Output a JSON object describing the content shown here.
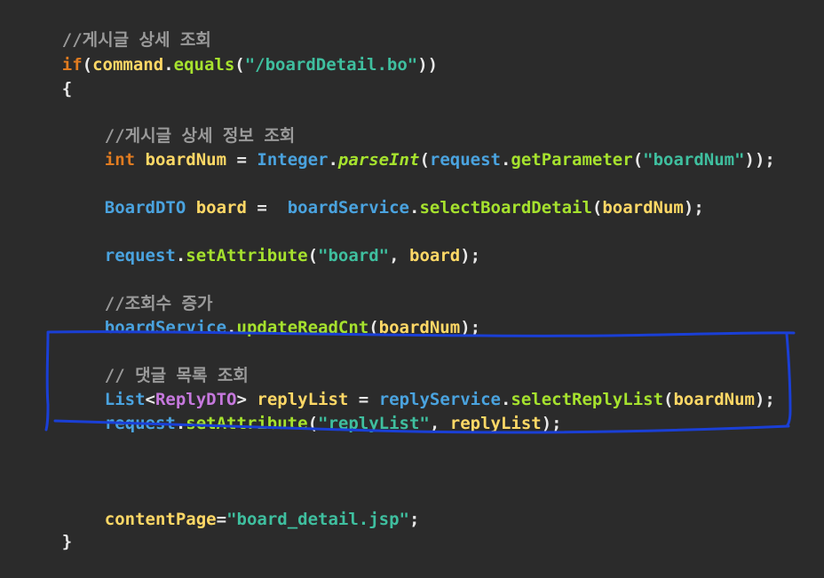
{
  "editor": {
    "lines": {
      "l1": {
        "comment": "//게시글 상세 조회"
      },
      "l2": {
        "kw": "if",
        "open": "(",
        "obj": "command",
        "dot": ".",
        "method": "equals",
        "p1": "(",
        "str": "\"/boardDetail.bo\"",
        "close": "))"
      },
      "l3": {
        "brace": "{"
      },
      "l5": {
        "comment": "//게시글 상세 정보 조회"
      },
      "l6": {
        "type": "int",
        "var": "boardNum",
        "eq": " = ",
        "cls": "Integer",
        "dot": ".",
        "method": "parseInt",
        "p1": "(",
        "obj": "request",
        "dot2": ".",
        "method2": "getParameter",
        "p2": "(",
        "str": "\"boardNum\"",
        "close": "));"
      },
      "l8": {
        "type": "BoardDTO",
        "var": "board",
        "eq": " =  ",
        "obj": "boardService",
        "dot": ".",
        "method": "selectBoardDetail",
        "p1": "(",
        "arg": "boardNum",
        "close": ");"
      },
      "l10": {
        "obj": "request",
        "dot": ".",
        "method": "setAttribute",
        "p1": "(",
        "str": "\"board\"",
        "comma": ", ",
        "arg": "board",
        "close": ");"
      },
      "l12": {
        "comment": "//조회수 증가"
      },
      "l13": {
        "obj": "boardService",
        "dot": ".",
        "method": "updateReadCnt",
        "p1": "(",
        "arg": "boardNum",
        "close": ");"
      },
      "l15": {
        "comment": "// 댓글 목록 조회"
      },
      "l16": {
        "type": "List",
        "lt": "<",
        "generic": "ReplyDTO",
        "gt": ">",
        "var": "replyList",
        "eq": " = ",
        "obj": "replyService",
        "dot": ".",
        "method": "selectReplyList",
        "p1": "(",
        "arg": "boardNum",
        "close": ");"
      },
      "l17": {
        "obj": "request",
        "dot": ".",
        "method": "setAttribute",
        "p1": "(",
        "str": "\"replyList\"",
        "comma": ", ",
        "arg": "replyList",
        "close": ");"
      },
      "l20": {
        "var": "contentPage",
        "eq": "=",
        "str": "\"board_detail.jsp\"",
        "semi": ";"
      },
      "l21": {
        "brace": "}"
      }
    }
  },
  "colors": {
    "background": "#2b2b2b",
    "highlight_box": "#1a3fd6"
  }
}
